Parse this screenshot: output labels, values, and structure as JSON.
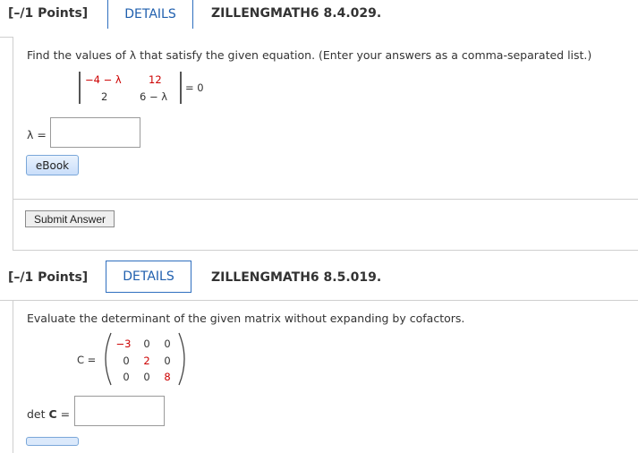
{
  "q1": {
    "points": "[–/1 Points]",
    "details": "DETAILS",
    "code": "ZILLENGMATH6 8.4.029.",
    "prompt": "Find the values of λ that satisfy the given equation. (Enter your answers as a comma-separated list.)",
    "matrix": {
      "a11": "−4 − λ",
      "a12": "12",
      "a21": "2",
      "a22": "6 − λ"
    },
    "equals": "= 0",
    "answer_label": "λ =",
    "answer_value": "",
    "ebook": "eBook",
    "submit": "Submit Answer"
  },
  "q2": {
    "points": "[–/1 Points]",
    "details": "DETAILS",
    "code": "ZILLENGMATH6 8.5.019.",
    "prompt": "Evaluate the determinant of the given matrix without expanding by cofactors.",
    "matrix_label": "C =",
    "matrix": [
      [
        "−3",
        "0",
        "0"
      ],
      [
        "0",
        "2",
        "0"
      ],
      [
        "0",
        "0",
        "8"
      ]
    ],
    "answer_label_pre": "det ",
    "answer_label_c": "C",
    "answer_label_post": " =",
    "answer_value": ""
  },
  "colors": {
    "accent": "#1f5fae",
    "red": "#cc0000",
    "border": "#cfcfcf"
  }
}
